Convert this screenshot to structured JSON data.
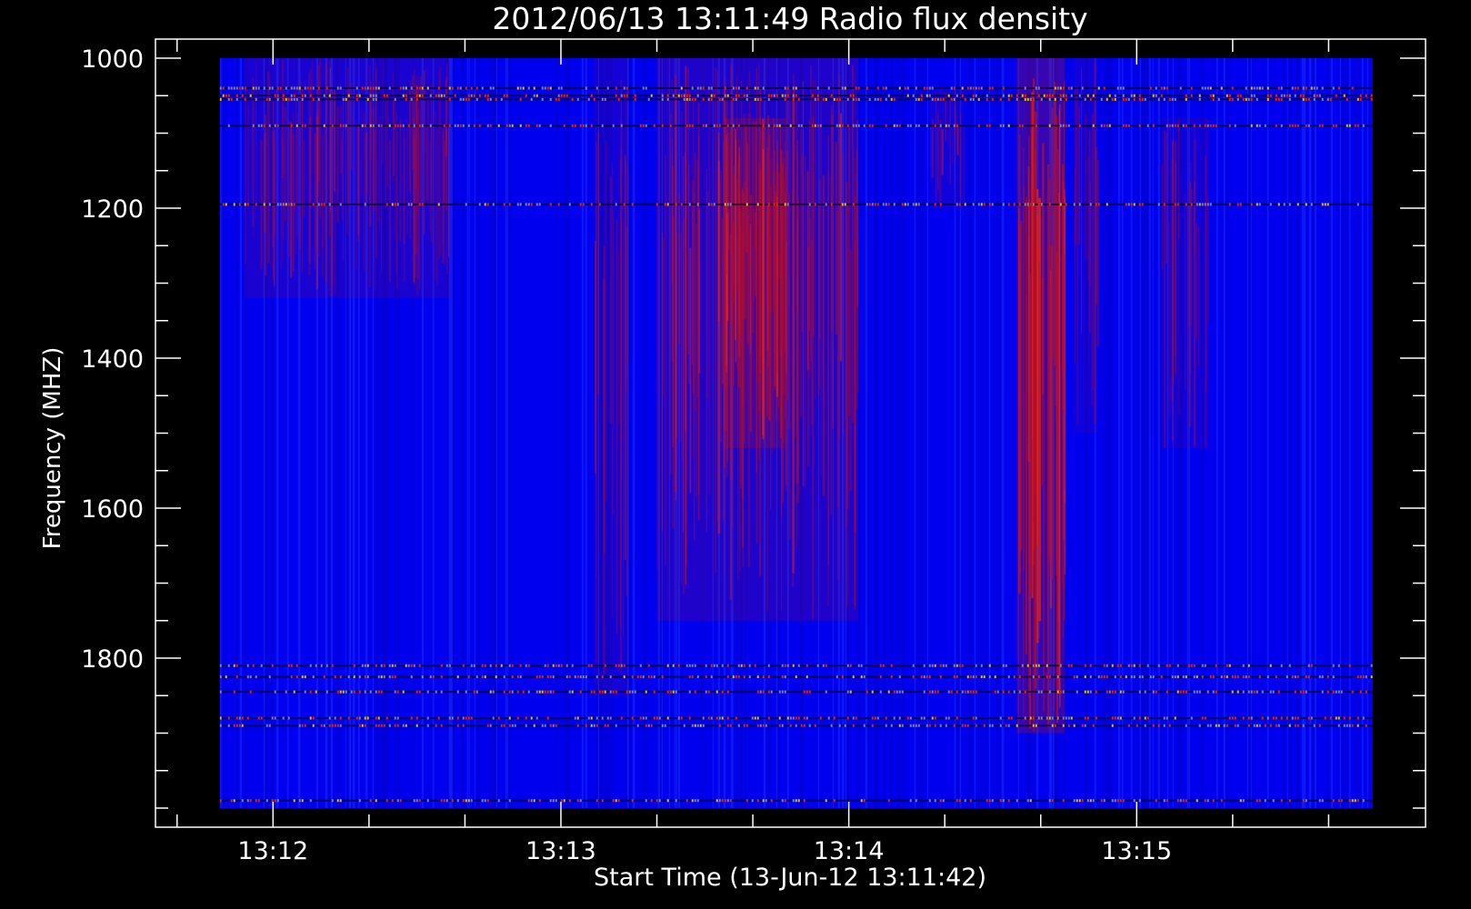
{
  "chart_data": {
    "type": "heatmap",
    "title": "2012/06/13 13:11:49 Radio flux density",
    "xlabel": "Start Time (13-Jun-12 13:11:42)",
    "ylabel": "Frequency (MHZ)",
    "x_ticks": [
      {
        "label": "13:12",
        "seconds": 18
      },
      {
        "label": "13:13",
        "seconds": 78
      },
      {
        "label": "13:14",
        "seconds": 138
      },
      {
        "label": "13:15",
        "seconds": 198
      }
    ],
    "x_minor_step_seconds": 20,
    "xlim_seconds": [
      -6.5,
      258.2
    ],
    "data_x_range_seconds": [
      6.9,
      247.2
    ],
    "y_ticks": [
      1000,
      1200,
      1400,
      1600,
      1800
    ],
    "y_minor_step": 50,
    "ylim": [
      1000,
      2000
    ],
    "data_y_range": [
      1000,
      2000
    ],
    "y_inverted": true,
    "grid": false,
    "colors": {
      "background": "#0000ee",
      "low": "#1a2cff",
      "mid": "#b40f28",
      "high": "#ff2a00",
      "peak": "#ffd400",
      "axis": "#ffffff",
      "page": "#000000"
    },
    "bursts": [
      {
        "t_start": 12,
        "t_end": 55,
        "f_start": 1000,
        "f_end": 1320,
        "intensity": 0.45
      },
      {
        "t_start": 85,
        "t_end": 92,
        "f_start": 1000,
        "f_end": 1850,
        "intensity": 0.35
      },
      {
        "t_start": 98,
        "t_end": 140,
        "f_start": 1000,
        "f_end": 1750,
        "intensity": 0.55
      },
      {
        "t_start": 112,
        "t_end": 125,
        "f_start": 1080,
        "f_end": 1520,
        "intensity": 0.75
      },
      {
        "t_start": 155,
        "t_end": 162,
        "f_start": 1040,
        "f_end": 1200,
        "intensity": 0.3
      },
      {
        "t_start": 173,
        "t_end": 183,
        "f_start": 1000,
        "f_end": 1900,
        "intensity": 0.95
      },
      {
        "t_start": 185,
        "t_end": 190,
        "f_start": 1000,
        "f_end": 1500,
        "intensity": 0.3
      },
      {
        "t_start": 203,
        "t_end": 213,
        "f_start": 1080,
        "f_end": 1520,
        "intensity": 0.3
      }
    ],
    "interference_bands_mhz": [
      1040,
      1050,
      1055,
      1090,
      1195,
      1810,
      1825,
      1845,
      1880,
      1890,
      1990
    ]
  }
}
